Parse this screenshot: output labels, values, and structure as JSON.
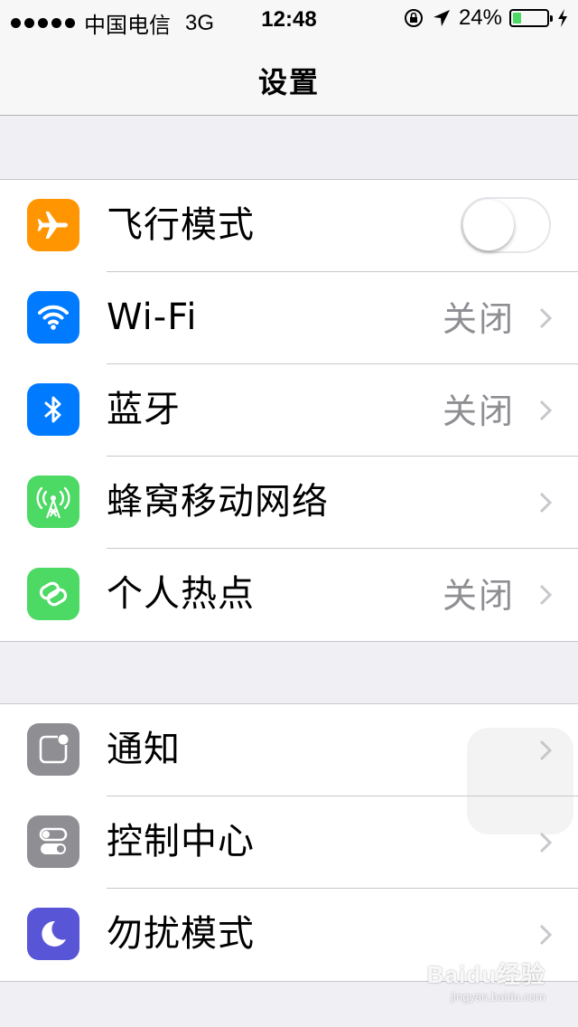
{
  "status_bar": {
    "carrier": "中国电信",
    "network": "3G",
    "time": "12:48",
    "battery_percent": "24%",
    "battery_level": 0.24,
    "battery_color": "#4cd964",
    "icons": [
      "signal-dots-icon",
      "orientation-lock-icon",
      "location-arrow-icon",
      "battery-icon",
      "charging-bolt-icon"
    ]
  },
  "nav": {
    "title": "设置"
  },
  "groups": [
    {
      "items": [
        {
          "label": "飞行模式",
          "icon": "airplane-icon",
          "icon_bg": "#ff9500",
          "control": "toggle",
          "toggle_on": false
        },
        {
          "label": "Wi-Fi",
          "icon": "wifi-icon",
          "icon_bg": "#007aff",
          "value": "关闭"
        },
        {
          "label": "蓝牙",
          "icon": "bluetooth-icon",
          "icon_bg": "#007aff",
          "value": "关闭"
        },
        {
          "label": "蜂窝移动网络",
          "icon": "cellular-antenna-icon",
          "icon_bg": "#4cd964"
        },
        {
          "label": "个人热点",
          "icon": "hotspot-link-icon",
          "icon_bg": "#4cd964",
          "value": "关闭"
        }
      ]
    },
    {
      "items": [
        {
          "label": "通知",
          "icon": "notifications-icon",
          "icon_bg": "#8e8e93"
        },
        {
          "label": "控制中心",
          "icon": "control-center-icon",
          "icon_bg": "#8e8e93"
        },
        {
          "label": "勿扰模式",
          "icon": "moon-icon",
          "icon_bg": "#5856d6"
        }
      ]
    }
  ],
  "watermark": {
    "main": "Baidu经验",
    "sub": "jingyan.baidu.com"
  }
}
